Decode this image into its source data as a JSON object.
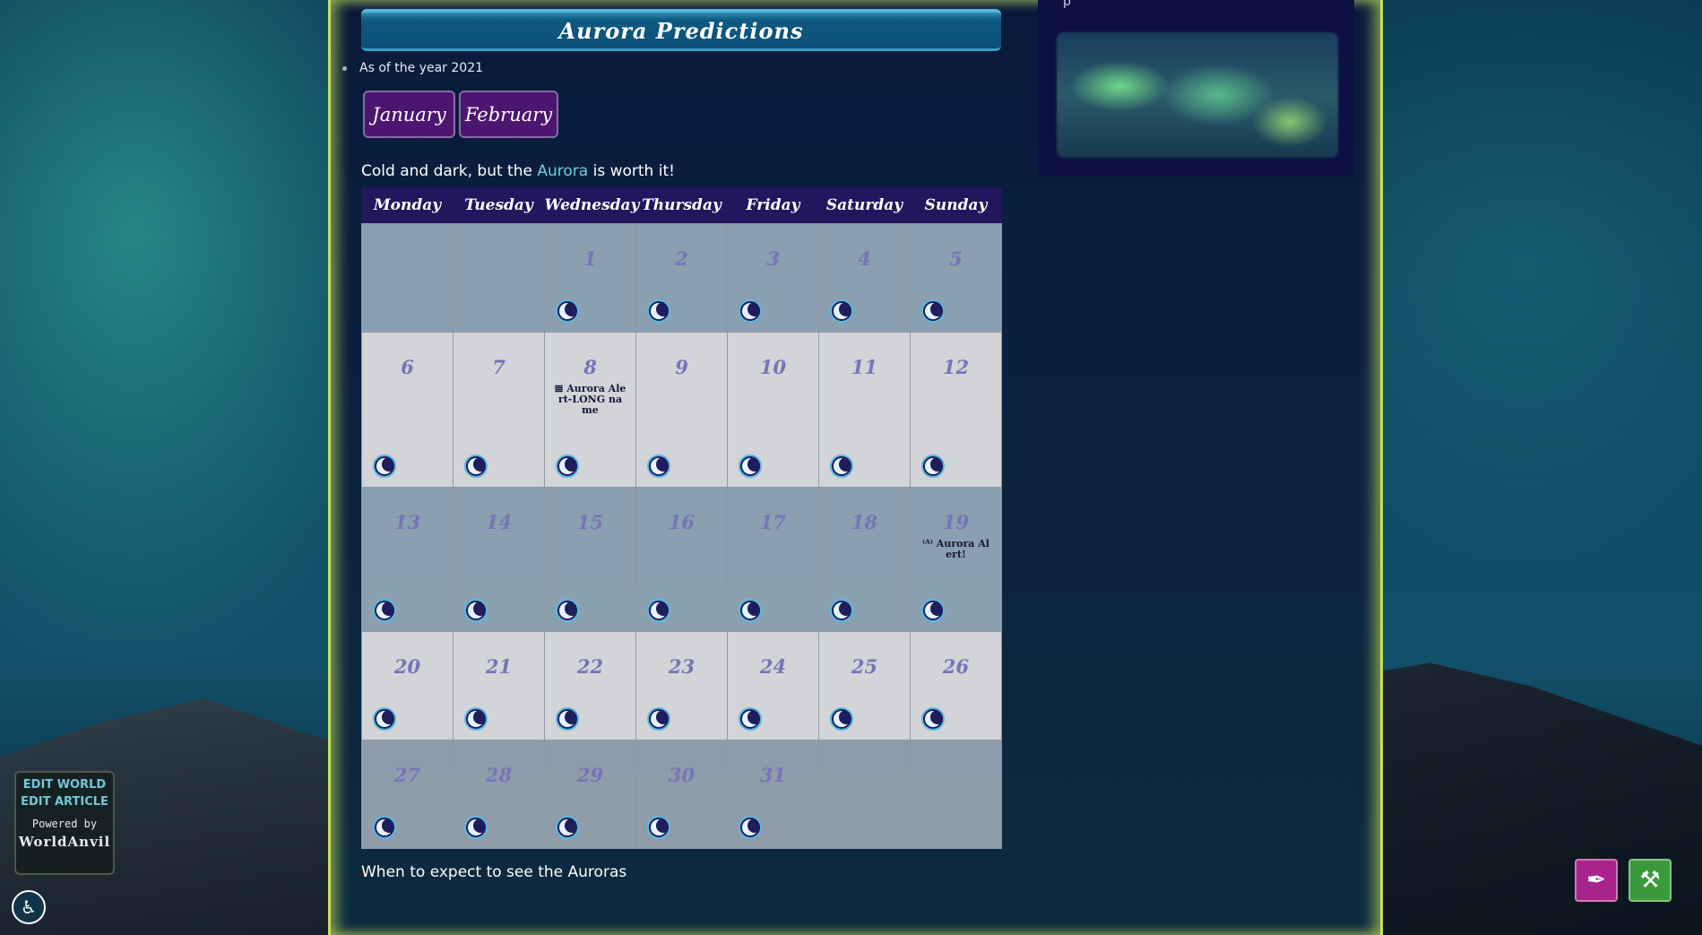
{
  "header": {
    "title": "Aurora Predictions",
    "year_line": "As of the year 2021"
  },
  "months": [
    "January",
    "February"
  ],
  "subtitle": {
    "before": "Cold and dark, but the ",
    "link": "Aurora",
    "after": " is worth it!"
  },
  "calendar": {
    "weekdays": [
      "Monday",
      "Tuesday",
      "Wednesday",
      "Thursday",
      "Friday",
      "Saturday",
      "Sunday"
    ],
    "weeks": [
      [
        "",
        "",
        "1",
        "2",
        "3",
        "4",
        "5"
      ],
      [
        "6",
        "7",
        "8",
        "9",
        "10",
        "11",
        "12"
      ],
      [
        "13",
        "14",
        "15",
        "16",
        "17",
        "18",
        "19"
      ],
      [
        "20",
        "21",
        "22",
        "23",
        "24",
        "25",
        "26"
      ],
      [
        "27",
        "28",
        "29",
        "30",
        "31",
        "",
        ""
      ]
    ],
    "events": {
      "8": "𝌆 Aurora Alert-LONG name",
      "19": "⁽ᴬ⁾ Aurora Alert!"
    }
  },
  "caption": "When to expect to see the Auroras",
  "side_panel": {
    "text": "p"
  },
  "edit_box": {
    "edit_world": "EDIT WORLD",
    "edit_article": "EDIT ARTICLE",
    "powered_by": "Powered by",
    "brand": "WorldAnvil"
  },
  "icons": {
    "accessibility": "accessibility-icon",
    "quill": "quill-icon",
    "hammer": "hammer-icon"
  },
  "colors": {
    "title_bar": "#0e5a82",
    "month_button": "#4c1670",
    "header_row": "#23165e",
    "link": "#6ed0e6",
    "quill_button": "#a8238c",
    "hammer_button": "#3a9a3a"
  }
}
